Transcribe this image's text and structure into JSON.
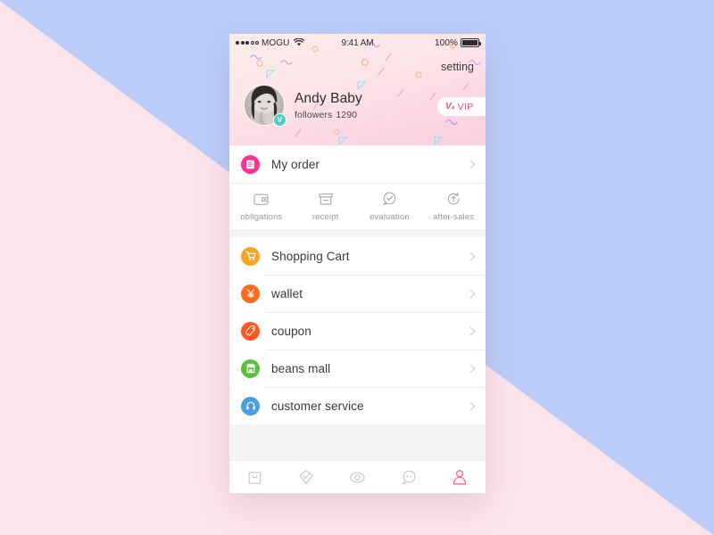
{
  "wallpaper": {
    "pink": "#FCE4EC",
    "blue": "#B9CDF8"
  },
  "statusbar": {
    "carrier": "MOGU",
    "time": "9:41 AM",
    "battery_percent": "100%",
    "wifi_icon": "wifi-icon",
    "signal_icon": "signal-dots-icon",
    "battery_icon": "battery-full-icon"
  },
  "header": {
    "setting_label": "setting",
    "avatar_icon": "user-photo-avatar",
    "verified_badge": "V",
    "name": "Andy Baby",
    "followers_label": "followers",
    "followers_count": "1290",
    "vip_label": "VIP",
    "vip_crown_icon": "crown-icon",
    "accent_pink": "#F44C7F",
    "verified_color": "#4ECDC4"
  },
  "order_card": {
    "title": "My order",
    "icon": "document-list-icon",
    "icon_color": "#F5368E",
    "chevron": "chevron-right-icon",
    "sub_items": [
      {
        "label": "obligations",
        "icon": "wallet-outline-icon"
      },
      {
        "label": "receipt",
        "icon": "package-box-outline-icon"
      },
      {
        "label": "evaluation",
        "icon": "speech-bubble-check-icon"
      },
      {
        "label": "after-sales",
        "icon": "return-refresh-icon"
      }
    ]
  },
  "menu_card": {
    "items": [
      {
        "label": "Shopping Cart",
        "icon": "shopping-cart-icon",
        "color": "#F6A623"
      },
      {
        "label": "wallet",
        "icon": "yen-currency-icon",
        "color": "#FF6B1A"
      },
      {
        "label": "coupon",
        "icon": "coupon-tag-icon",
        "color": "#FF5722"
      },
      {
        "label": "beans mall",
        "icon": "store-shop-icon",
        "color": "#5BBF3F"
      },
      {
        "label": "customer service",
        "icon": "headset-support-icon",
        "color": "#4A9FE0"
      }
    ],
    "chevron": "chevron-right-icon"
  },
  "tabbar": {
    "items": [
      {
        "name": "shopping-bag",
        "icon": "shopping-bag-icon",
        "active": false
      },
      {
        "name": "gem",
        "icon": "diamond-gem-icon",
        "active": false
      },
      {
        "name": "discover",
        "icon": "eye-discover-icon",
        "active": false
      },
      {
        "name": "messages",
        "icon": "chat-bubble-icon",
        "active": false
      },
      {
        "name": "profile",
        "icon": "person-profile-icon",
        "active": true
      }
    ],
    "active_color": "#FB5E7E",
    "inactive_color": "#C8C8C8"
  }
}
